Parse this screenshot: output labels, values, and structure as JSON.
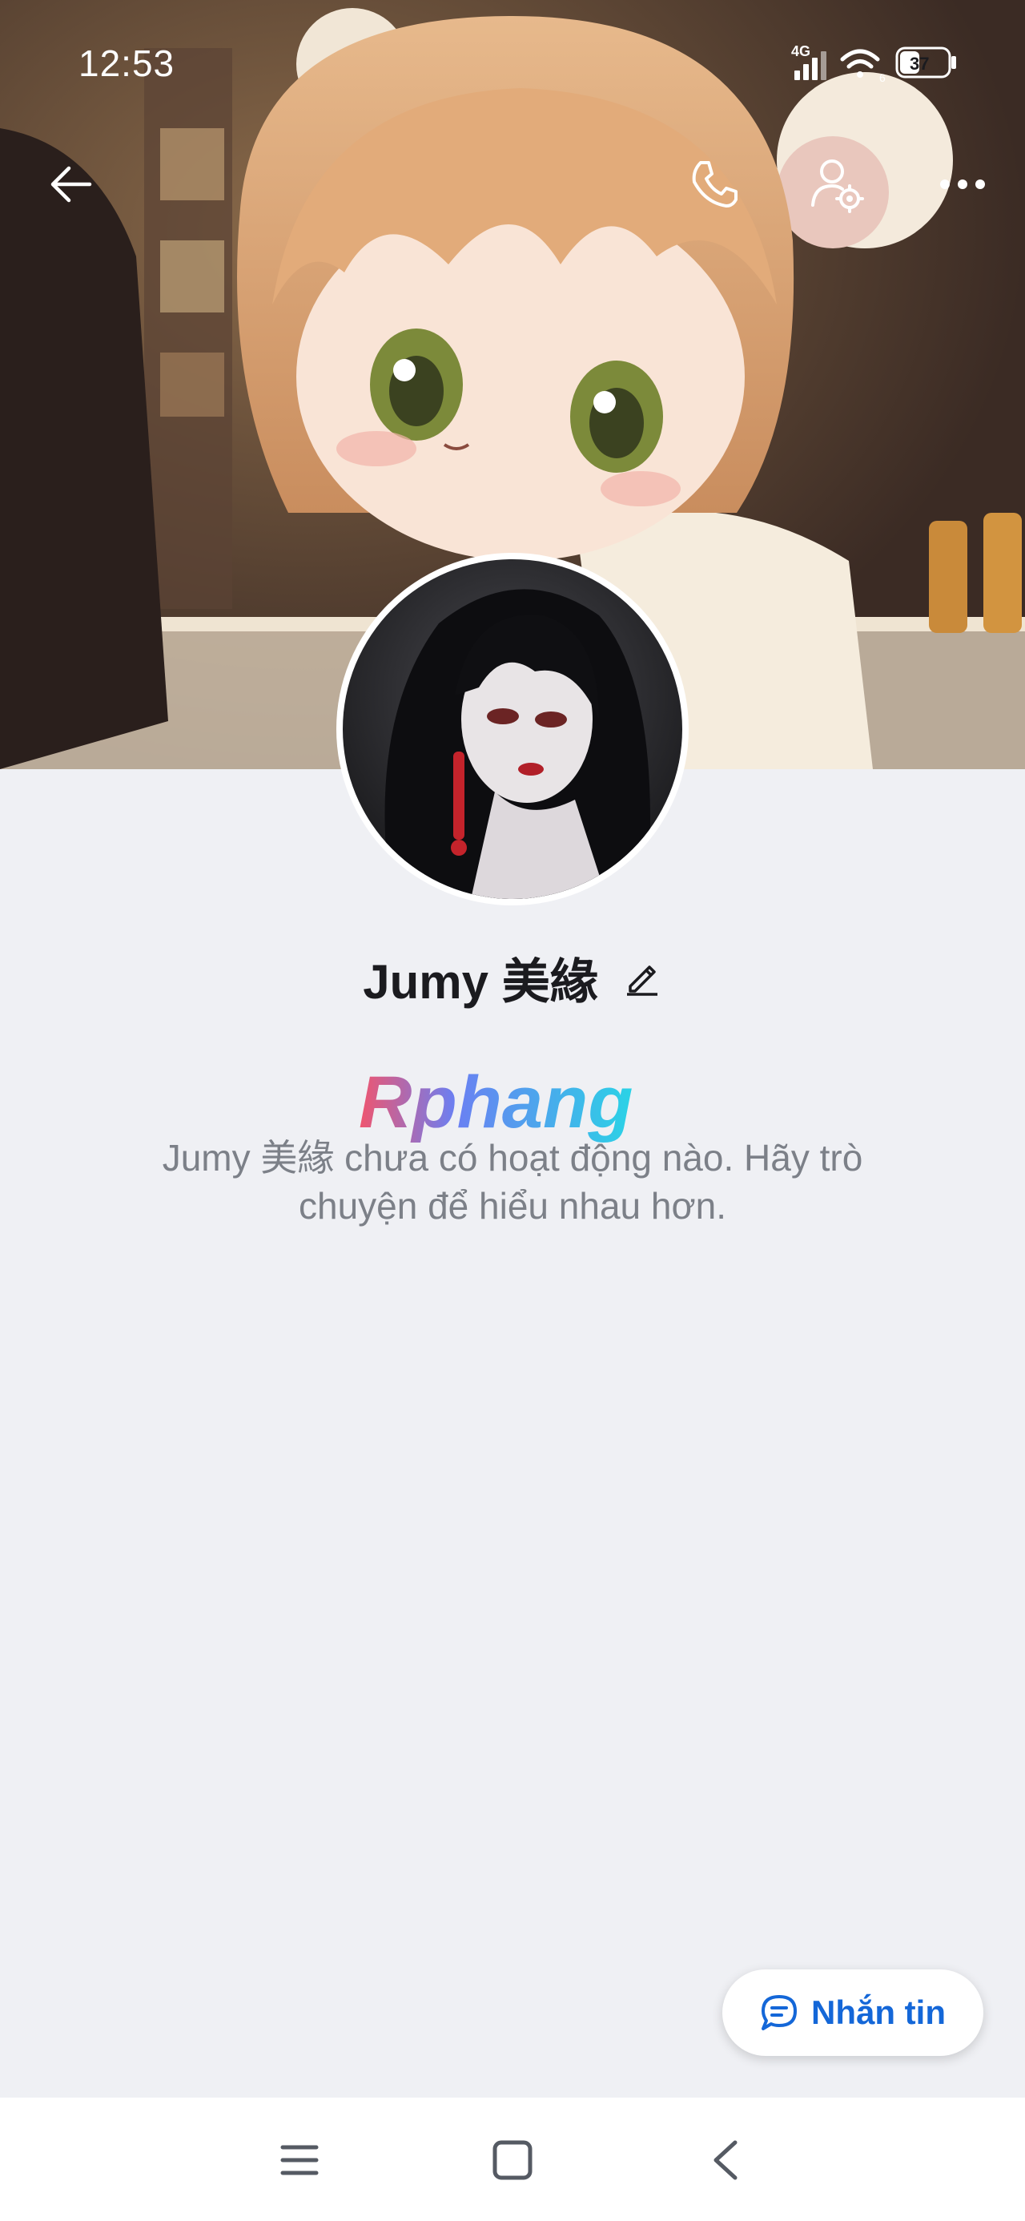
{
  "status_bar": {
    "time": "12:53",
    "network": "4G",
    "wifi_badge": "6",
    "battery": "37"
  },
  "top_nav": {
    "back_icon": "arrow-left-icon",
    "call_icon": "phone-icon",
    "settings_icon": "user-settings-icon",
    "more_icon": "more-horizontal-icon"
  },
  "profile": {
    "name": "Jumy 美緣",
    "edit_icon": "pencil-icon"
  },
  "watermark": {
    "text": "Rphang"
  },
  "empty_state": {
    "message": "Jumy 美緣 chưa có hoạt động nào. Hãy trò chuyện để hiểu nhau hơn."
  },
  "fab": {
    "label": "Nhắn tin",
    "icon": "chat-bubble-icon",
    "color": "#1467d8"
  },
  "system_nav": {
    "menu_icon": "menu-lines-icon",
    "home_icon": "home-square-icon",
    "back_icon": "chevron-left-icon"
  }
}
